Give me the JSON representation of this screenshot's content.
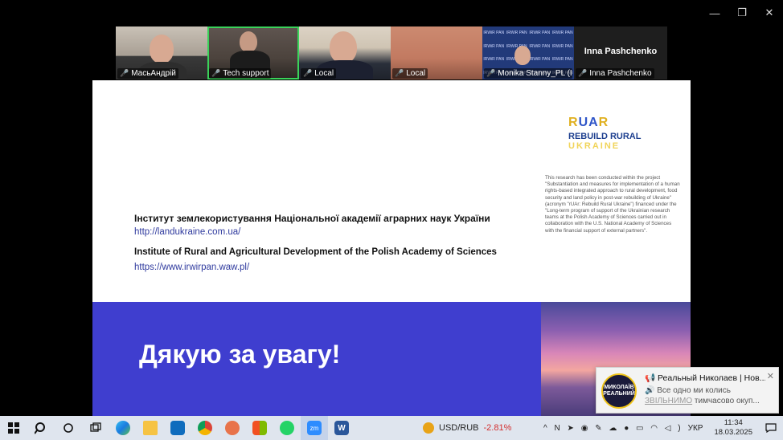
{
  "window": {
    "minimize": "—",
    "restore": "❐",
    "close": "✕"
  },
  "participants": [
    {
      "name": "МасьАндрій",
      "active": false
    },
    {
      "name": "Tech support",
      "active": true
    },
    {
      "name": "Local",
      "active": false
    },
    {
      "name": "Local",
      "active": false
    },
    {
      "name": "Monika Stanny_PL (IR...",
      "active": false
    },
    {
      "name": "Inna Pashchenko",
      "active": false,
      "display_name": "Inna Pashchenko"
    }
  ],
  "slide": {
    "org1": "Інститут землекористування Національної академії аграрних наук України",
    "link1": "http://landukraine.com.ua/",
    "org2": "Institute of Rural and Agricultural Development of the Polish Academy of Sciences",
    "link2": "https://www.irwirpan.waw.pl/",
    "logo_r": "R",
    "logo_ua": "UA",
    "logo_r2": "R",
    "logo_line2": "REBUILD RURAL",
    "logo_line3": "UKRAINE",
    "note": "This research has been conducted within the project \"Substantiation and measures for implementation of a human rights-based integrated approach to rural development, food security and land policy in post-war rebuilding of Ukraine\" (acronym \"rUAr: Rebuild Rural Ukraine\") financed under the \"Long-term program of support of the Ukrainian research teams at the Polish Academy of Sciences carried out in collaboration with the U.S. National Academy of Sciences with the financial support of external partners\".",
    "thanks": "Дякую за увагу!"
  },
  "toast": {
    "avatar_text": "МИКОЛАЇВ РЕАЛЬНИЙ",
    "title": "Реальный Николаев | Нов...",
    "line1": "Все одно ми колись",
    "line2_hl": "ЗВІЛЬНИМО",
    "line2_rest": " тимчасово окуп..."
  },
  "taskbar": {
    "ticker_label": "USD/RUB",
    "ticker_change": "-2.81%",
    "lang": "УКР",
    "time": "11:34",
    "date": "18.03.2025"
  }
}
